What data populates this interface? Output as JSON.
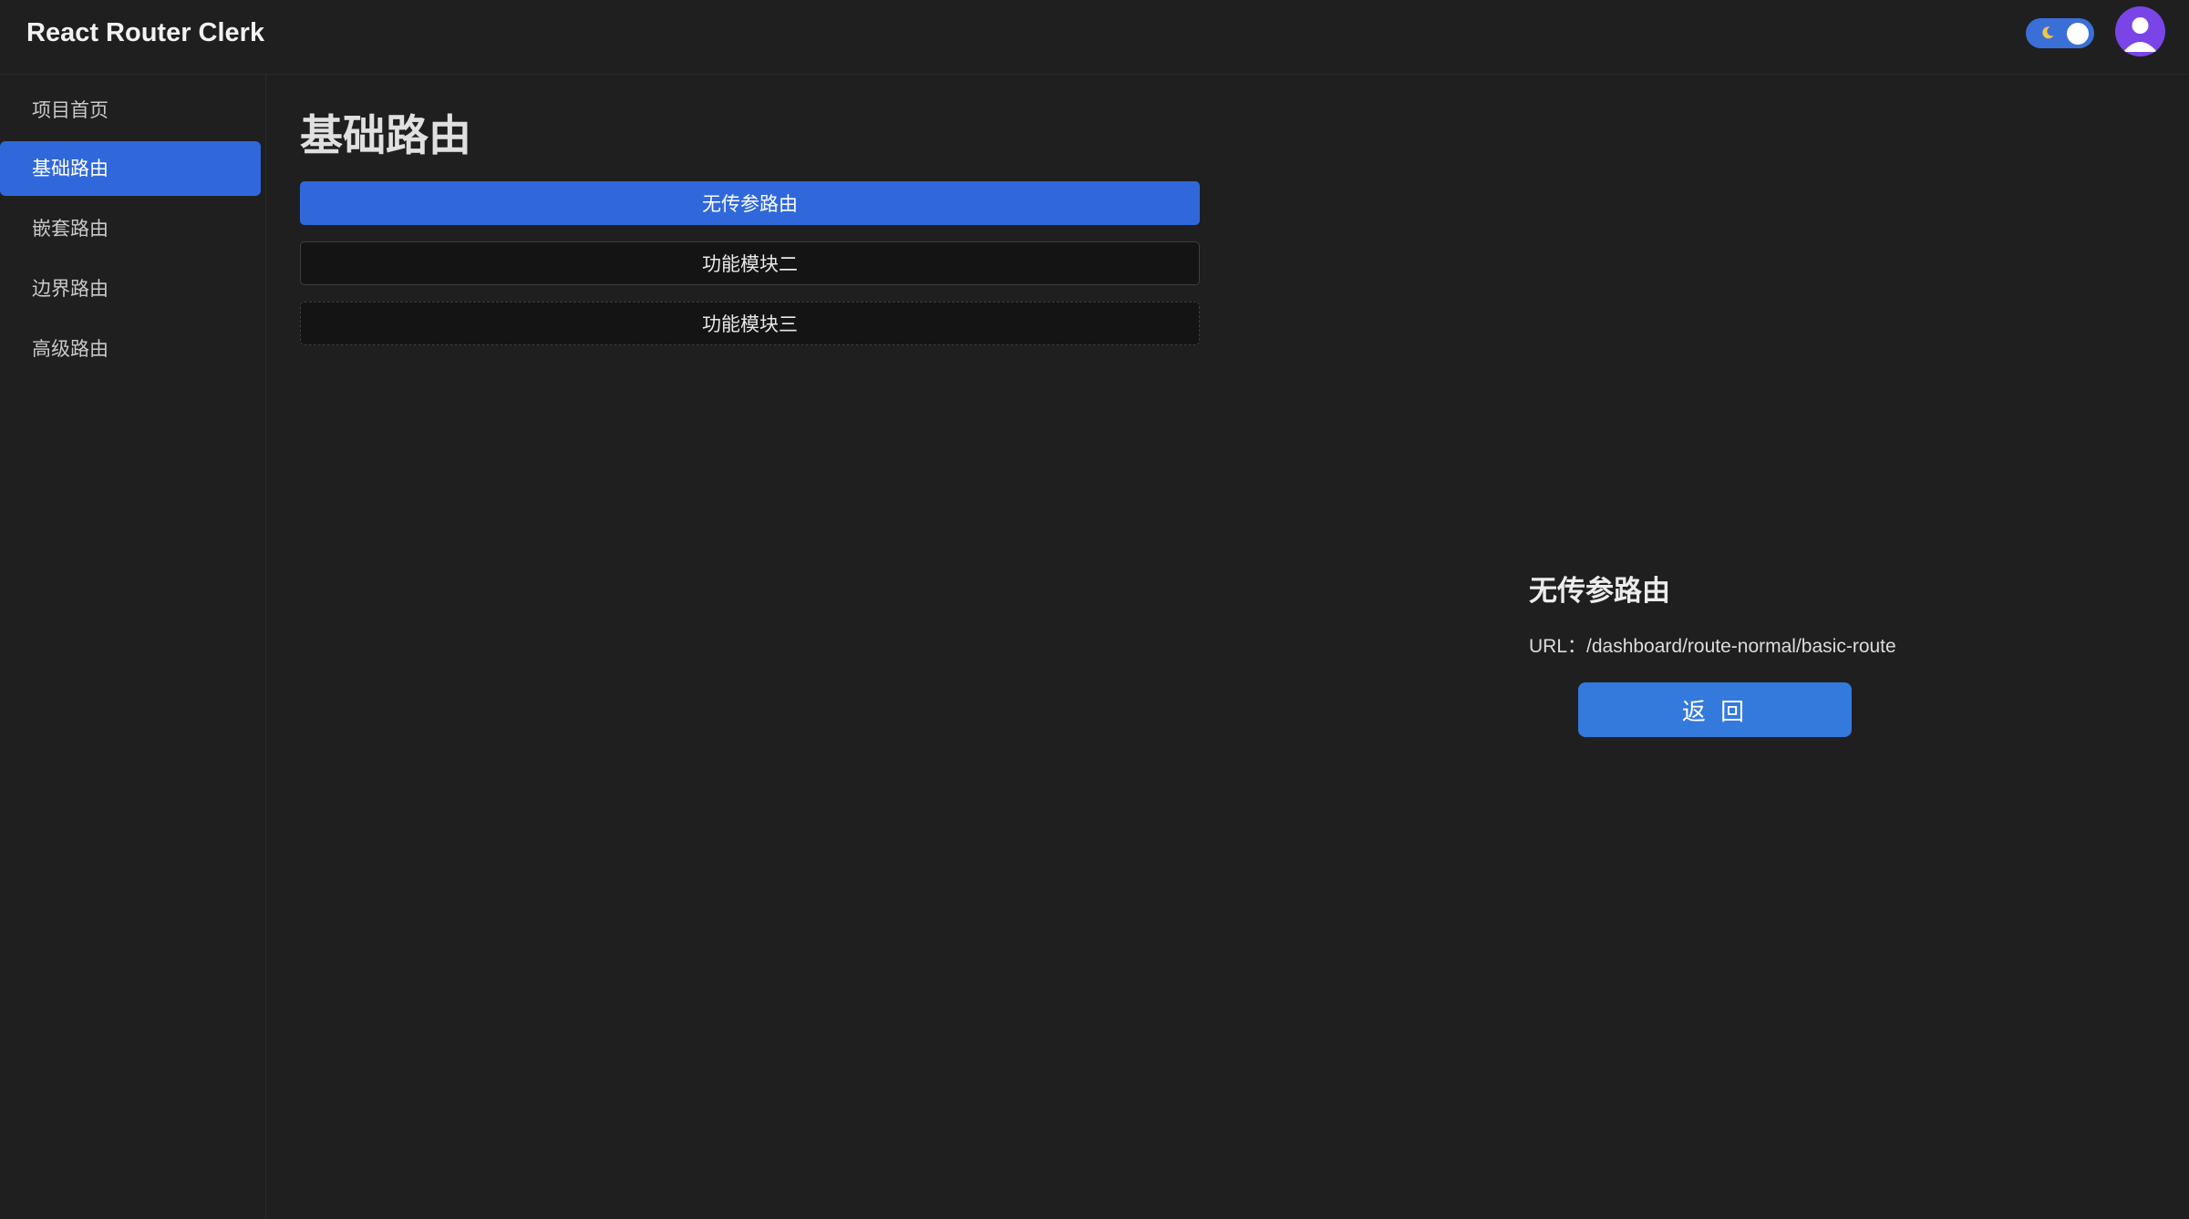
{
  "header": {
    "app_title": "React Router Clerk",
    "theme_toggle": {
      "state": "dark",
      "icon": "moon-icon",
      "color": "#3a6fd8"
    },
    "avatar": {
      "icon": "user-avatar-icon",
      "color": "#7a45e6"
    }
  },
  "sidebar": {
    "items": [
      {
        "label": "项目首页",
        "active": false
      },
      {
        "label": "基础路由",
        "active": true
      },
      {
        "label": "嵌套路由",
        "active": false
      },
      {
        "label": "边界路由",
        "active": false
      },
      {
        "label": "高级路由",
        "active": false
      }
    ],
    "active_color": "#3068db"
  },
  "main": {
    "title": "基础路由",
    "route_buttons": [
      {
        "label": "无传参路由",
        "style": "primary"
      },
      {
        "label": "功能模块二",
        "style": "outline"
      },
      {
        "label": "功能模块三",
        "style": "dashed"
      }
    ]
  },
  "detail": {
    "title": "无传参路由",
    "url_text": "URL：/dashboard/route-normal/basic-route",
    "back_label": "返 回"
  }
}
